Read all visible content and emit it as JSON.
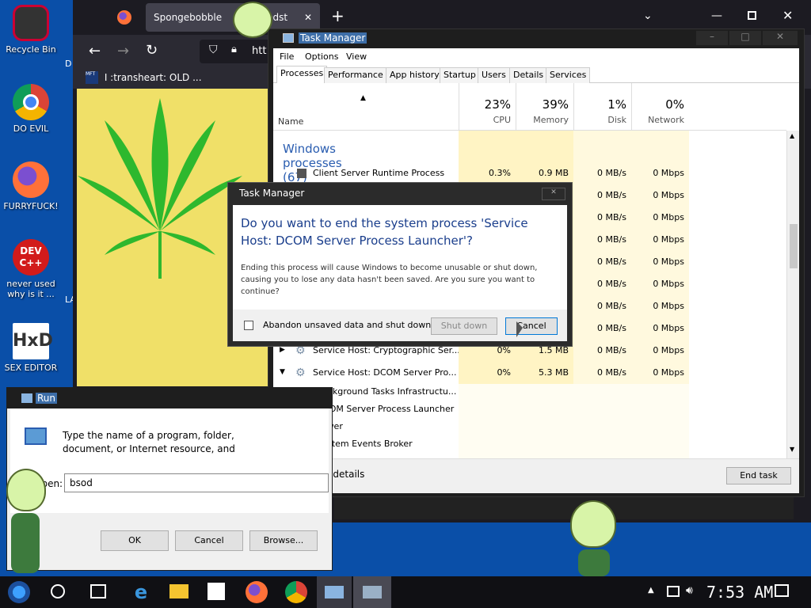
{
  "desktop": {
    "icons": [
      {
        "label": "Recycle Bin"
      },
      {
        "label": "DO EVIL"
      },
      {
        "label": "FURRYFUCK!"
      },
      {
        "label": "never used why is it ..."
      },
      {
        "label": "SEX EDITOR"
      }
    ],
    "side_labels": {
      "d": "D",
      "la": "LA"
    }
  },
  "browser": {
    "tab_title": "Spongebobble ",
    "tab_suffix": "weedst",
    "url": "htt",
    "bookmark": "I :transheart: OLD ...",
    "bookmark_icon_text": "MFT"
  },
  "task_manager": {
    "title": "Task Manager",
    "menu": [
      "File",
      "Options",
      "View"
    ],
    "tabs": [
      "Processes",
      "Performance",
      "App history",
      "Startup",
      "Users",
      "Details",
      "Services"
    ],
    "columns": {
      "name": "Name",
      "cpu_pct": "23%",
      "cpu": "CPU",
      "mem_pct": "39%",
      "mem": "Memory",
      "disk_pct": "1%",
      "disk": "Disk",
      "net_pct": "0%",
      "net": "Network"
    },
    "group_label": "Windows processes (67)",
    "rows": [
      {
        "name": "Client Server Runtime Process",
        "cpu": "0.3%",
        "mem": "0.9 MB",
        "disk": "0 MB/s",
        "net": "0 Mbps"
      },
      {
        "name": "",
        "cpu": "",
        "mem": "",
        "disk": "0 MB/s",
        "net": "0 Mbps"
      },
      {
        "name": "",
        "cpu": "",
        "mem": "",
        "disk": "0 MB/s",
        "net": "0 Mbps"
      },
      {
        "name": "",
        "cpu": "",
        "mem": "",
        "disk": "0 MB/s",
        "net": "0 Mbps"
      },
      {
        "name": "",
        "cpu": "",
        "mem": "",
        "disk": "0 MB/s",
        "net": "0 Mbps"
      },
      {
        "name": "",
        "cpu": "",
        "mem": "",
        "disk": "0 MB/s",
        "net": "0 Mbps"
      },
      {
        "name": "",
        "cpu": "",
        "mem": "",
        "disk": "0 MB/s",
        "net": "0 Mbps"
      },
      {
        "name": "",
        "cpu": "",
        "mem": "",
        "disk": "0 MB/s",
        "net": "0 Mbps"
      },
      {
        "name": "Service Host: Cryptographic Ser...",
        "cpu": "0%",
        "mem": "1.5 MB",
        "disk": "0 MB/s",
        "net": "0 Mbps"
      },
      {
        "name": "Service Host: DCOM Server Pro...",
        "cpu": "0%",
        "mem": "5.3 MB",
        "disk": "0 MB/s",
        "net": "0 Mbps"
      }
    ],
    "children": [
      "Background Tasks Infrastructu...",
      "DCOM Server Process Launcher",
      "Power",
      "System Events Broker"
    ],
    "fewer_details": "Fewer details",
    "end_task": "End task"
  },
  "dialog": {
    "title": "Task Manager",
    "heading": "Do you want to end the system process 'Service Host: DCOM Server Process Launcher'?",
    "body": "Ending this process will cause Windows to become unusable or shut down, causing you to lose any data hasn't been saved. Are you sure you want to continue?",
    "checkbox": "Abandon unsaved data and shut down.",
    "shutdown": "Shut down",
    "cancel": "Cancel"
  },
  "run": {
    "title": "Run",
    "description": "Type the name of a program, folder, document, or Internet resource, and Windows will open it for you.",
    "open_label": "Open:",
    "value": "bsod",
    "ok": "OK",
    "cancel": "Cancel",
    "browse": "Browse..."
  },
  "taskbar": {
    "time": "7:53 AM"
  },
  "colors": {
    "desktop": "#0a4fa8",
    "browser_dark": "#1c1b22",
    "accent_blue": "#2a5db0",
    "cpu_highlight": "#fff4c4"
  }
}
